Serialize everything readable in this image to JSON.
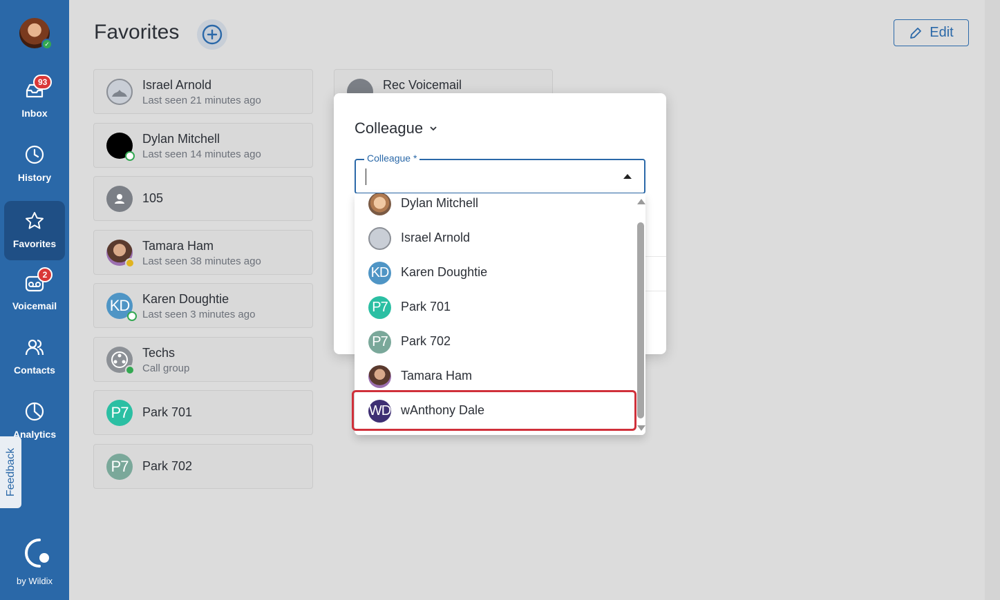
{
  "sidebar": {
    "items": [
      {
        "label": "Inbox",
        "icon": "inbox-icon",
        "badge": "93"
      },
      {
        "label": "History",
        "icon": "clock-icon"
      },
      {
        "label": "Favorites",
        "icon": "star-icon",
        "active": true
      },
      {
        "label": "Voicemail",
        "icon": "voicemail-icon",
        "badge": "2"
      },
      {
        "label": "Contacts",
        "icon": "contacts-icon"
      },
      {
        "label": "Analytics",
        "icon": "analytics-icon"
      }
    ],
    "feedback": "Feedback",
    "brand": "by Wildix"
  },
  "header": {
    "title": "Favorites",
    "edit_label": "Edit"
  },
  "favorites": [
    {
      "name": "Israel Arnold",
      "sub": "Last seen 21 minutes ago",
      "avatar_type": "photo"
    },
    {
      "name": "Dylan Mitchell",
      "sub": "Last seen 14 minutes ago",
      "avatar_type": "photo",
      "status": "online"
    },
    {
      "name": "105",
      "sub": "",
      "avatar_type": "generic"
    },
    {
      "name": "Tamara Ham",
      "sub": "Last seen 38 minutes ago",
      "avatar_type": "photo",
      "status": "away"
    },
    {
      "name": "Karen Doughtie",
      "sub": "Last seen 3 minutes ago",
      "initials": "KD",
      "status": "online-ring"
    },
    {
      "name": "Techs",
      "sub": "Call group",
      "avatar_type": "group",
      "status": "online"
    },
    {
      "name": "Park 701",
      "sub": "",
      "initials": "P7"
    },
    {
      "name": "Park 702",
      "sub": "",
      "initials": "P7"
    }
  ],
  "favorites_col2": [
    {
      "name": "Rec Voicemail"
    }
  ],
  "dialog": {
    "type_label": "Colleague",
    "field_label": "Colleague *",
    "field_value": "",
    "options": [
      {
        "label": "Dylan Mitchell",
        "avatar_type": "photo"
      },
      {
        "label": "Israel Arnold",
        "avatar_type": "photo"
      },
      {
        "label": "Karen Doughtie",
        "initials": "KD"
      },
      {
        "label": "Park 701",
        "initials": "P7"
      },
      {
        "label": "Park 702",
        "initials": "P7"
      },
      {
        "label": "Tamara Ham",
        "avatar_type": "photo"
      },
      {
        "label": "wAnthony Dale",
        "initials": "WD",
        "highlighted": true
      }
    ]
  },
  "colors": {
    "sidebar": "#2a68a8",
    "accent": "#2a68a8",
    "highlight": "#d0303a",
    "kd": "#4f95c5",
    "p701": "#2bbfa3",
    "p702": "#7aa89a",
    "wd": "#3e2f73"
  }
}
